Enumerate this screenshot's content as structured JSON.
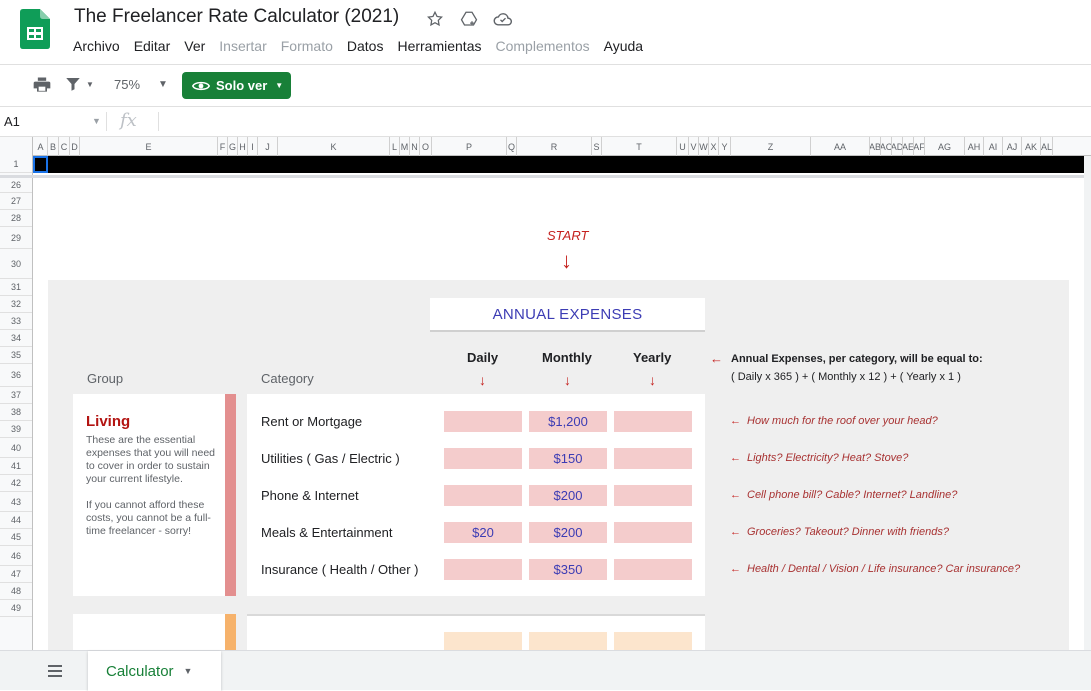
{
  "app": {
    "title": "The Freelancer Rate Calculator (2021)",
    "menus": [
      {
        "label": "Archivo",
        "enabled": true
      },
      {
        "label": "Editar",
        "enabled": true
      },
      {
        "label": "Ver",
        "enabled": true
      },
      {
        "label": "Insertar",
        "enabled": false
      },
      {
        "label": "Formato",
        "enabled": false
      },
      {
        "label": "Datos",
        "enabled": true
      },
      {
        "label": "Herramientas",
        "enabled": true
      },
      {
        "label": "Complementos",
        "enabled": false
      },
      {
        "label": "Ayuda",
        "enabled": true
      }
    ]
  },
  "toolbar": {
    "zoom": "75%",
    "view_mode_label": "Solo ver"
  },
  "formula_bar": {
    "cell_ref": "A1",
    "fx": "fx"
  },
  "columns": [
    "A",
    "B",
    "C",
    "D",
    "E",
    "F",
    "G",
    "H",
    "I",
    "J",
    "K",
    "L",
    "M",
    "N",
    "O",
    "P",
    "Q",
    "R",
    "S",
    "T",
    "U",
    "V",
    "W",
    "X",
    "Y",
    "Z",
    "AA",
    "AB",
    "AC",
    "AD",
    "AE",
    "AF",
    "AG",
    "AH",
    "AI",
    "AJ",
    "AK",
    "AL"
  ],
  "rows": [
    "1",
    "26",
    "27",
    "28",
    "29",
    "30",
    "31",
    "32",
    "33",
    "34",
    "35",
    "36",
    "37",
    "38",
    "39",
    "40",
    "41",
    "42",
    "43",
    "44",
    "45",
    "46",
    "47",
    "48",
    "49"
  ],
  "sheet": {
    "start_label": "START",
    "start_arrow": "↓",
    "section_title": "ANNUAL EXPENSES",
    "group_header": "Group",
    "category_header": "Category",
    "period_headers": [
      "Daily",
      "Monthly",
      "Yearly"
    ],
    "period_arrow": "↓",
    "note_arrow": "←",
    "note_heading": "Annual Expenses, per category, will be equal to:",
    "note_formula": "( Daily x 365 )  +  ( Monthly x 12 )  +  ( Yearly x 1 )",
    "living": {
      "title": "Living",
      "description_1": "These are the essential expenses that you will need to cover in order to sustain your current lifestyle.",
      "description_2": "If you cannot afford these costs, you cannot be a full-time freelancer - sorry!",
      "accent_color": "#e38f8f"
    },
    "expenses": [
      {
        "category": "Rent or Mortgage",
        "daily": "",
        "monthly": "$1,200",
        "yearly": "",
        "hint": "How much for the roof over your head?"
      },
      {
        "category": "Utilities  ( Gas / Electric )",
        "daily": "",
        "monthly": "$150",
        "yearly": "",
        "hint": "Lights? Electricity? Heat? Stove?"
      },
      {
        "category": "Phone & Internet",
        "daily": "",
        "monthly": "$200",
        "yearly": "",
        "hint": "Cell phone bill? Cable? Internet? Landline?"
      },
      {
        "category": "Meals & Entertainment",
        "daily": "$20",
        "monthly": "$200",
        "yearly": "",
        "hint": "Groceries? Takeout? Dinner with friends?"
      },
      {
        "category": "Insurance  ( Health / Other )",
        "daily": "",
        "monthly": "$350",
        "yearly": "",
        "hint": "Health / Dental / Vision / Life insurance? Car insurance?"
      }
    ],
    "next_group_accent": "#f6b26b"
  },
  "bottom": {
    "sheet_tab": "Calculator"
  },
  "colors": {
    "brand_green": "#188038",
    "cell_pink": "#f4cccc",
    "value_blue": "#3c3cb4",
    "accent_red": "#c5221f"
  }
}
